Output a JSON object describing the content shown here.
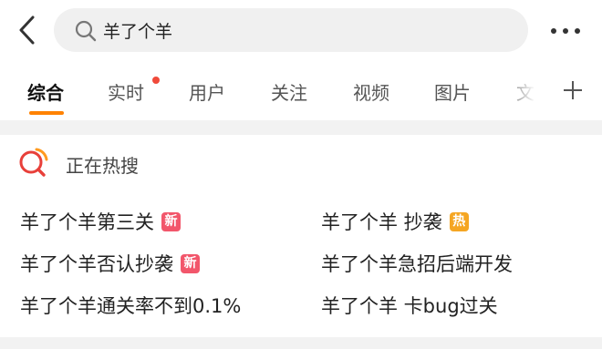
{
  "search": {
    "query": "羊了个羊"
  },
  "tabs": [
    {
      "label": "综合",
      "active": true
    },
    {
      "label": "实时",
      "has_dot": true
    },
    {
      "label": "用户"
    },
    {
      "label": "关注"
    },
    {
      "label": "视频"
    },
    {
      "label": "图片"
    },
    {
      "label": "文"
    }
  ],
  "hot_search": {
    "title": "正在热搜",
    "items": [
      {
        "text": "羊了个羊第三关",
        "badge": "新",
        "badge_type": "new"
      },
      {
        "text": "羊了个羊 抄袭",
        "badge": "热",
        "badge_type": "hot"
      },
      {
        "text": "羊了个羊否认抄袭",
        "badge": "新",
        "badge_type": "new"
      },
      {
        "text": "羊了个羊急招后端开发"
      },
      {
        "text": "羊了个羊通关率不到0.1%"
      },
      {
        "text": "羊了个羊 卡bug过关"
      }
    ]
  },
  "colors": {
    "accent": "#ff8200",
    "badge_new": "#f2566b",
    "badge_hot": "#f5a623",
    "dot": "#f04a3a"
  }
}
